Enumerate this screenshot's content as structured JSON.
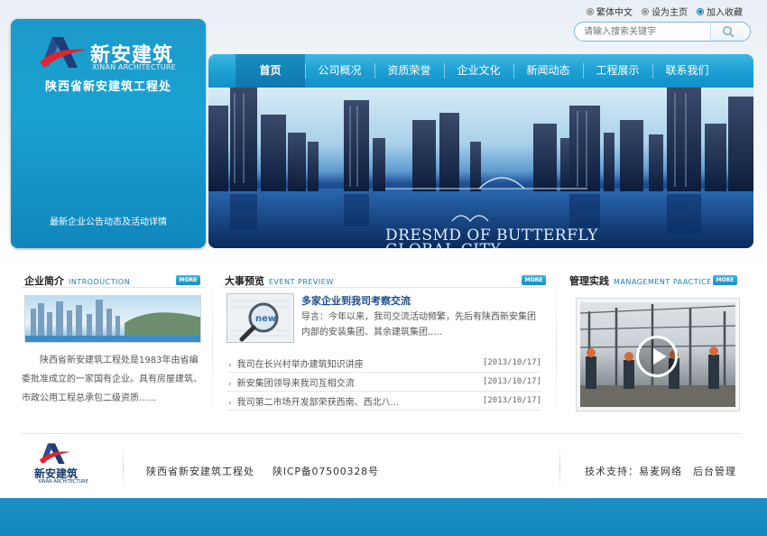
{
  "toplinks": [
    {
      "label": "繁体中文",
      "selected": false
    },
    {
      "label": "设为主页",
      "selected": false
    },
    {
      "label": "加入收藏",
      "selected": true
    }
  ],
  "search": {
    "placeholder": "请输入搜索关键字"
  },
  "logo": {
    "name_cn": "新安建筑",
    "name_en": "XINAN ARCHITECTURE",
    "org": "陕西省新安建筑工程处",
    "notice": "最新企业公告动态及活动详情"
  },
  "nav": [
    {
      "label": "首页",
      "active": true
    },
    {
      "label": "公司概况",
      "active": false
    },
    {
      "label": "资质荣誉",
      "active": false
    },
    {
      "label": "企业文化",
      "active": false
    },
    {
      "label": "新闻动态",
      "active": false
    },
    {
      "label": "工程展示",
      "active": false
    },
    {
      "label": "联系我们",
      "active": false
    }
  ],
  "banner": {
    "line1": "DRESMD OF BUTTERFLY",
    "line2": "GLOBAL CITY"
  },
  "sections": {
    "intro": {
      "title_cn": "企业简介",
      "title_en": "INTRODUCTION",
      "more": "MORE"
    },
    "events": {
      "title_cn": "大事预览",
      "title_en": "EVENT PREVIEW",
      "more": "MORE"
    },
    "practice": {
      "title_cn": "管理实践",
      "title_en": "MANAGEMENT PAACTICE",
      "more": "MORE"
    }
  },
  "intro": {
    "text": "陕西省新安建筑工程处是1983年由省编委批准成立的一家国有企业。具有房屋建筑、市政公用工程总承包二级资质......"
  },
  "events": {
    "thumb_label": "new",
    "featured_title": "多家企业到我司考察交流",
    "featured_summary": "导言：今年以来，我司交流活动频繁，先后有陕西新安集团内部的安装集团、其余建筑集团.....",
    "items": [
      {
        "title": "我司在长兴村举办建筑知识讲座",
        "date": "[2013/10/17]"
      },
      {
        "title": "新安集团领导来我司互相交流",
        "date": "[2013/10/17]"
      },
      {
        "title": "我司第二市场开发部荣获西南、西北八...",
        "date": "[2013/10/17]"
      }
    ]
  },
  "footer": {
    "logo_cn": "新安建筑",
    "logo_en": "XINAN ARCHITECTURE",
    "org": "陕西省新安建筑工程处",
    "icp": "陕ICP备07500328号",
    "tech": "技术支持：易麦网络",
    "admin": "后台管理"
  },
  "colors": {
    "primary": "#1a9ad0",
    "nav_active": "#0d78ad",
    "title_blue": "#1a4f8a"
  }
}
